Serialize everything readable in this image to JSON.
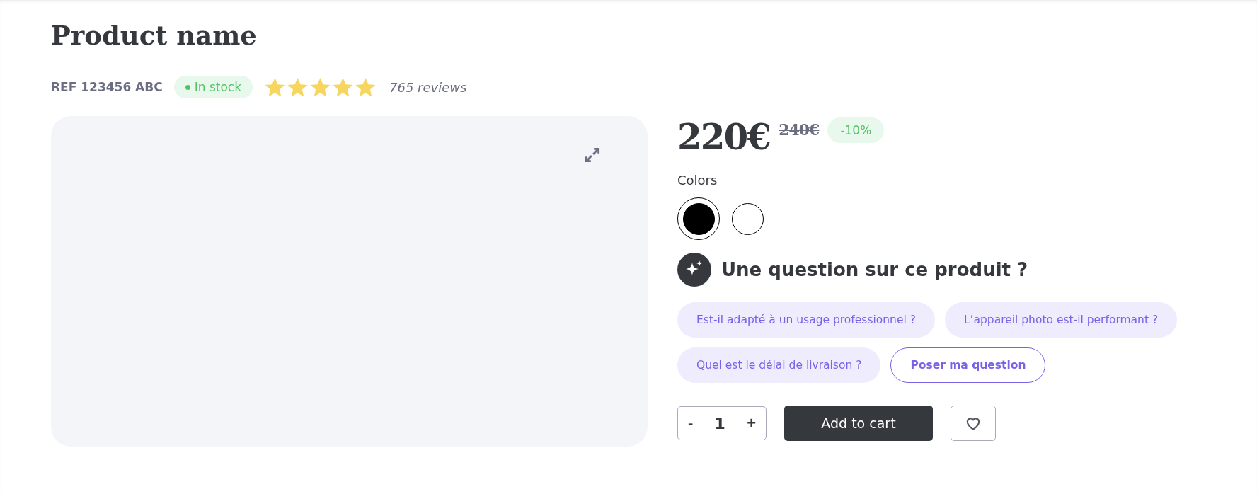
{
  "product": {
    "title": "Product name",
    "ref": "REF 123456 ABC",
    "stock": {
      "label": "In stock",
      "in_stock": true
    },
    "rating": {
      "stars": 5
    },
    "reviews": "765 reviews"
  },
  "price": {
    "current": "220€",
    "old": "240€",
    "discount": "-10%"
  },
  "colors": {
    "label": "Colors",
    "items": [
      {
        "color": "#000000",
        "selected": true
      },
      {
        "color": "#ffffff",
        "selected": false
      }
    ]
  },
  "questions": {
    "title": "Une question sur ce produit ?",
    "chips": [
      {
        "label": "Est-il adapté à un usage professionnel ?",
        "kind": "suggestion"
      },
      {
        "label": "L’appareil photo est-il performant ?",
        "kind": "suggestion"
      },
      {
        "label": "Quel est le délai de livraison ?",
        "kind": "suggestion"
      },
      {
        "label": "Poser ma question",
        "kind": "ask"
      }
    ]
  },
  "cart": {
    "minus": "-",
    "quantity": "1",
    "plus": "+",
    "add": "Add to cart"
  }
}
